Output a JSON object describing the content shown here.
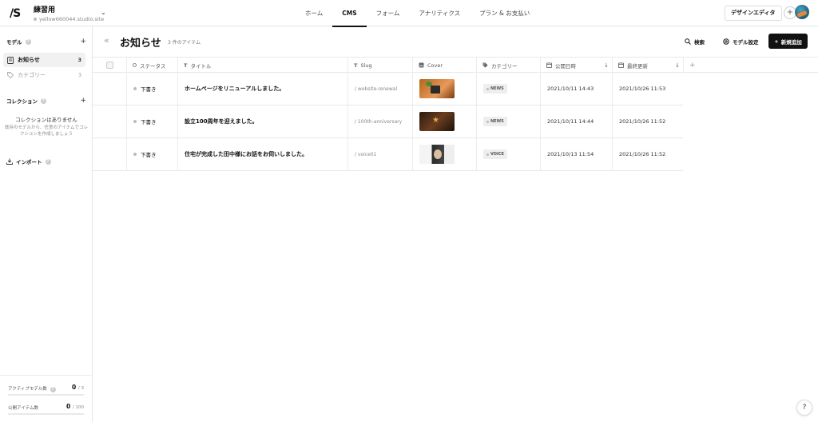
{
  "app": {
    "logo": "/S",
    "project_name": "練習用",
    "project_url": "yellow660044.studio.site"
  },
  "nav": {
    "items": [
      "ホーム",
      "CMS",
      "フォーム",
      "アナリティクス",
      "プラン & お支払い"
    ],
    "active": "CMS"
  },
  "topbar": {
    "design_editor_label": "デザインエディタ",
    "plus": "+"
  },
  "sidebar": {
    "models_heading": "モデル",
    "models": [
      {
        "label": "お知らせ",
        "count": "3",
        "active": true
      },
      {
        "label": "カテゴリー",
        "count": "3",
        "active": false
      }
    ],
    "collections_heading": "コレクション",
    "collections_empty_title": "コレクションはありません",
    "collections_empty_desc": "既存のモデルから、任意のアイテムでコレクションを作成しましょう",
    "import_label": "インポート",
    "active_models_label": "アクティブモデル数",
    "active_models_value": "0",
    "active_models_limit": "/ 3",
    "public_items_label": "公開アイテム数",
    "public_items_value": "0",
    "public_items_limit": "/ 100"
  },
  "main": {
    "title": "お知らせ",
    "item_count": "3 件のアイテム",
    "search_label": "検索",
    "model_settings_label": "モデル設定",
    "new_label": "新規追加"
  },
  "table": {
    "columns": [
      "ステータス",
      "タイトル",
      "Slug",
      "Cover",
      "カテゴリー",
      "公開日時",
      "最終更新"
    ],
    "rows": [
      {
        "status": "下書き",
        "title": "ホームページをリニューアルしました。",
        "slug": "/ website-renewal",
        "category": "NEWS",
        "published": "2021/10/11 14:43",
        "updated": "2021/10/26 11:53"
      },
      {
        "status": "下書き",
        "title": "設立100周年を迎えました。",
        "slug": "/ 100th-anniversary",
        "category": "NEWS",
        "published": "2021/10/11 14:44",
        "updated": "2021/10/26 11:52"
      },
      {
        "status": "下書き",
        "title": "住宅が完成した田中様にお話をお伺いしました。",
        "slug": "/ voice01",
        "category": "VOICE",
        "published": "2021/10/13 11:54",
        "updated": "2021/10/26 11:52"
      }
    ]
  },
  "help_label": "?"
}
